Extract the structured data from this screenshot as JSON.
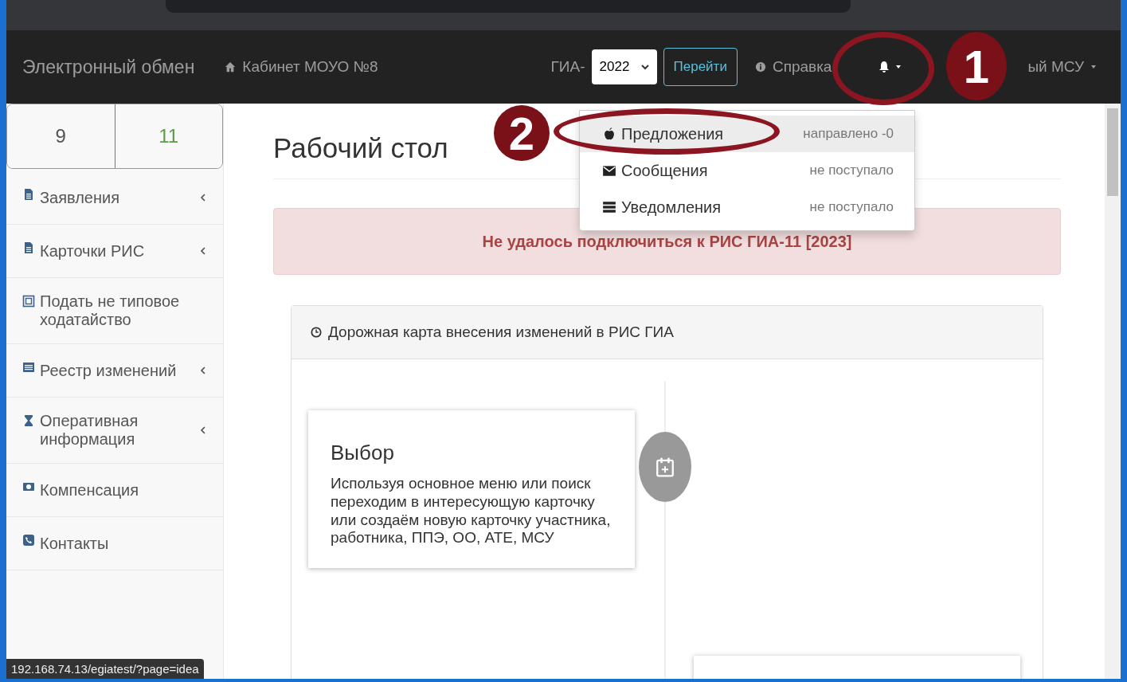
{
  "brand": "Электронный обмен",
  "nav": {
    "cabinet": "Кабинет МОУО №8",
    "gia_label": "ГИА-",
    "year": "2022",
    "go_button": "Перейти",
    "help": "Справка",
    "user": "ый МСУ"
  },
  "grade_tabs": [
    {
      "label": "9",
      "selected": false
    },
    {
      "label": "11",
      "selected": true
    }
  ],
  "sidebar": {
    "items": [
      {
        "label": "Заявления",
        "kind": "file",
        "expandable": true
      },
      {
        "label": "Карточки РИС",
        "kind": "file",
        "expandable": true
      },
      {
        "label": "Подать не типовое ходатайство",
        "kind": "frame",
        "expandable": false
      },
      {
        "label": "Реестр изменений",
        "kind": "list",
        "expandable": true
      },
      {
        "label": "Оперативная информация",
        "kind": "hourglass",
        "expandable": true
      },
      {
        "label": "Компенсация",
        "kind": "money",
        "expandable": false
      },
      {
        "label": "Контакты",
        "kind": "phone",
        "expandable": false
      }
    ]
  },
  "notifications": [
    {
      "label": "Предложения",
      "status": "направлено -0",
      "kind": "apple",
      "selected": true
    },
    {
      "label": "Сообщения",
      "status": "не поступало",
      "kind": "envelope",
      "selected": false
    },
    {
      "label": "Уведомления",
      "status": "не поступало",
      "kind": "list",
      "selected": false
    }
  ],
  "page_title": "Рабочий стол",
  "alert": "Не удалось подключиться к РИС ГИА-11 [2023]",
  "roadmap": {
    "title": "Дорожная карта внесения изменений в РИС ГИА",
    "steps": [
      {
        "title": "Выбор",
        "text": "Используя основное меню или поиск переходим в интересующую карточку или создаём новую карточку участника, работника, ППЭ, ОО, АТЕ, МСУ"
      }
    ]
  },
  "annotations": [
    {
      "label": "1"
    },
    {
      "label": "2"
    }
  ],
  "status_url": "192.168.74.13/egiatest/?page=idea"
}
